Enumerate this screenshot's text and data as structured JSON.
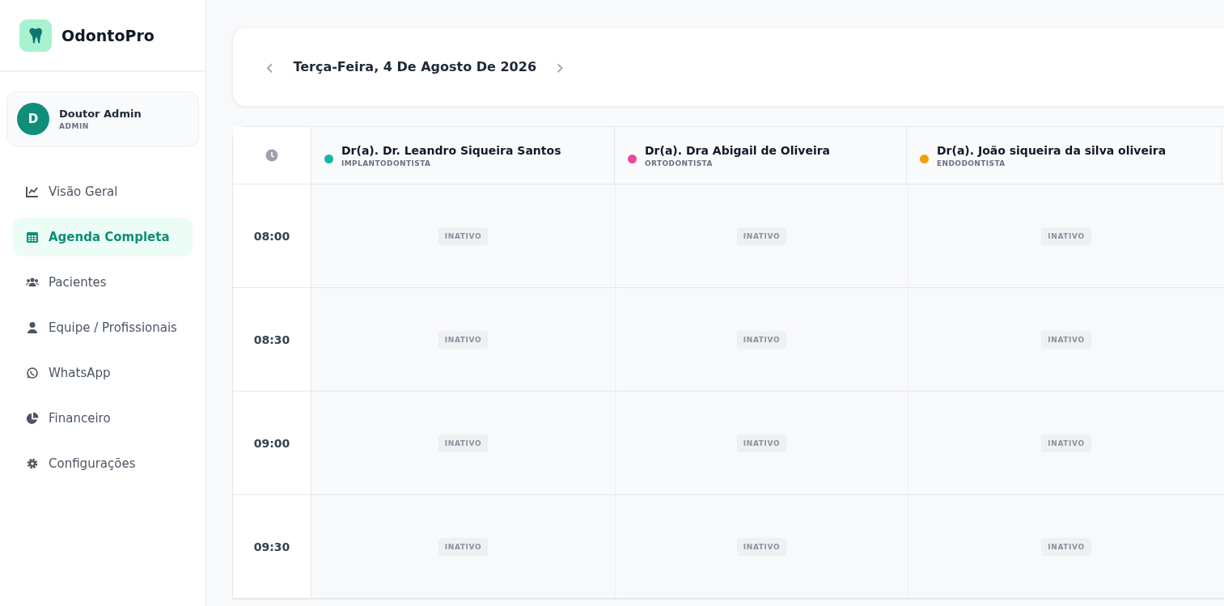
{
  "sidebar": {
    "brand": "OdontoPro",
    "user": {
      "initial": "D",
      "name": "Doutor Admin",
      "role": "ADMIN"
    },
    "items": [
      {
        "label": "Visão Geral",
        "selected": false
      },
      {
        "label": "Agenda Completa",
        "selected": true
      },
      {
        "label": "Pacientes",
        "selected": false
      },
      {
        "label": "Equipe / Profissionais",
        "selected": false
      },
      {
        "label": "WhatsApp",
        "selected": false
      },
      {
        "label": "Financeiro",
        "selected": false
      },
      {
        "label": "Configurações",
        "selected": false
      }
    ]
  },
  "date_bar": {
    "prev": "‹",
    "date": "Terça-Feira, 4 De Agosto De 2026",
    "next": "›"
  },
  "schedule": {
    "doctors": [
      {
        "name": "Dr(a). Dr. Leandro Siqueira Santos",
        "specialty": "IMPLANTODONTISTA",
        "color": "#14b8a6"
      },
      {
        "name": "Dr(a). Dra Abigail de Oliveira",
        "specialty": "ORTODONTISTA",
        "color": "#ec4899"
      },
      {
        "name": "Dr(a). João siqueira da silva oliveira",
        "specialty": "ENDODONTISTA",
        "color": "#f59e0b"
      }
    ],
    "rows": [
      {
        "time": "08:00",
        "slots": [
          "INATIVO",
          "INATIVO",
          "INATIVO"
        ]
      },
      {
        "time": "08:30",
        "slots": [
          "INATIVO",
          "INATIVO",
          "INATIVO"
        ]
      },
      {
        "time": "09:00",
        "slots": [
          "INATIVO",
          "INATIVO",
          "INATIVO"
        ]
      },
      {
        "time": "09:30",
        "slots": [
          "INATIVO",
          "INATIVO",
          "INATIVO"
        ]
      }
    ]
  }
}
